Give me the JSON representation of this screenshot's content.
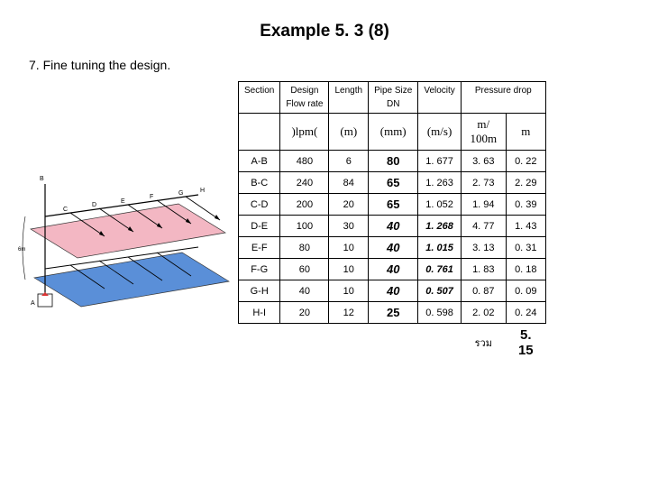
{
  "title": "Example 5. 3 (8)",
  "subtitle": "7. Fine tuning the design.",
  "headers": {
    "section": "Section",
    "design1": "Design",
    "design2": "Flow rate",
    "length": "Length",
    "pipe1": "Pipe Size",
    "pipe2": "DN",
    "velocity": "Velocity",
    "pdrop": "Pressure drop",
    "u_flow": ")lpm(",
    "u_len": "(m)",
    "u_pipe": "(mm)",
    "u_vel": "(m/s)",
    "u_p1": "m/ 100m",
    "u_p2": "m"
  },
  "rows": [
    {
      "sec": "A-B",
      "flow": "480",
      "len": "6",
      "pipe": "80",
      "vel": "1. 677",
      "p1": "3. 63",
      "p2": "0. 22",
      "flag": false
    },
    {
      "sec": "B-C",
      "flow": "240",
      "len": "84",
      "pipe": "65",
      "vel": "1. 263",
      "p1": "2. 73",
      "p2": "2. 29",
      "flag": false
    },
    {
      "sec": "C-D",
      "flow": "200",
      "len": "20",
      "pipe": "65",
      "vel": "1. 052",
      "p1": "1. 94",
      "p2": "0. 39",
      "flag": false
    },
    {
      "sec": "D-E",
      "flow": "100",
      "len": "30",
      "pipe": "40",
      "vel": "1. 268",
      "p1": "4. 77",
      "p2": "1. 43",
      "flag": true
    },
    {
      "sec": "E-F",
      "flow": "80",
      "len": "10",
      "pipe": "40",
      "vel": "1. 015",
      "p1": "3. 13",
      "p2": "0. 31",
      "flag": true
    },
    {
      "sec": "F-G",
      "flow": "60",
      "len": "10",
      "pipe": "40",
      "vel": "0. 761",
      "p1": "1. 83",
      "p2": "0. 18",
      "flag": true
    },
    {
      "sec": "G-H",
      "flow": "40",
      "len": "10",
      "pipe": "40",
      "vel": "0. 507",
      "p1": "0. 87",
      "p2": "0. 09",
      "flag": true
    },
    {
      "sec": "H-I",
      "flow": "20",
      "len": "12",
      "pipe": "25",
      "vel": "0. 598",
      "p1": "2. 02",
      "p2": "0. 24",
      "flag": false
    }
  ],
  "sum": {
    "label": "รวม",
    "value": "5. 15"
  }
}
